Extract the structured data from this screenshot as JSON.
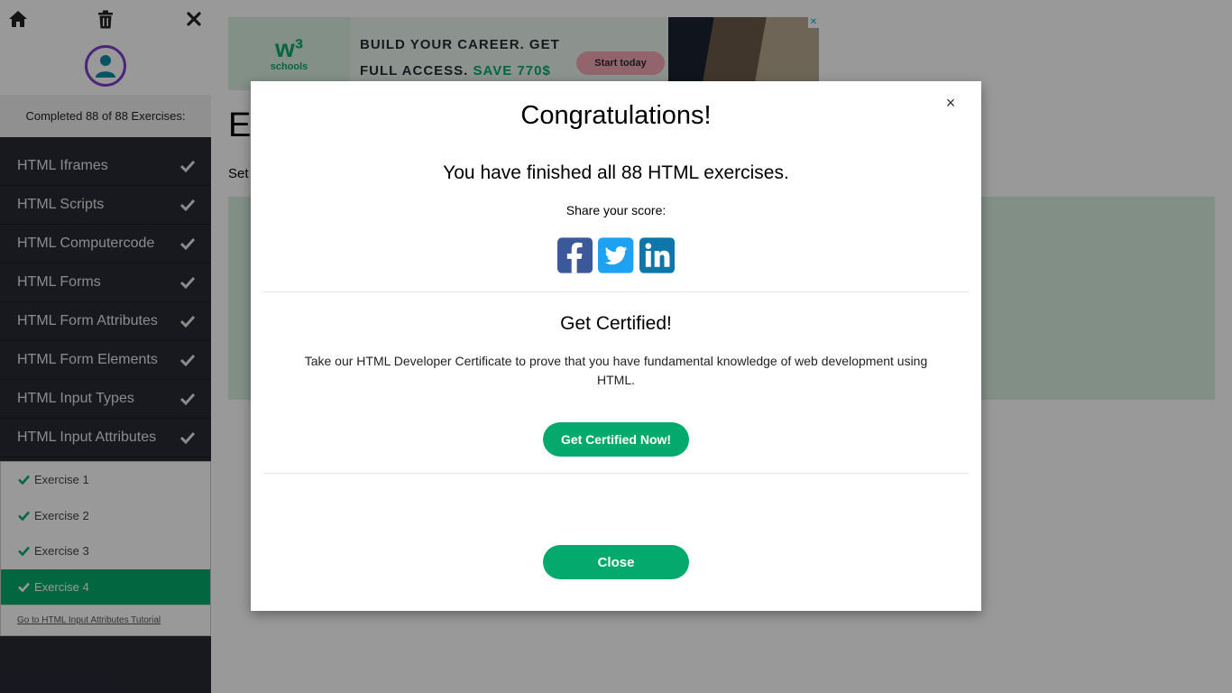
{
  "sidebar": {
    "progress_text": "Completed 88 of 88 Exercises:",
    "topics": [
      {
        "label": "HTML Iframes"
      },
      {
        "label": "HTML Scripts"
      },
      {
        "label": "HTML Computercode"
      },
      {
        "label": "HTML Forms"
      },
      {
        "label": "HTML Form Attributes"
      },
      {
        "label": "HTML Form Elements"
      },
      {
        "label": "HTML Input Types"
      },
      {
        "label": "HTML Input Attributes"
      }
    ],
    "exercises": [
      {
        "label": "Exercise 1"
      },
      {
        "label": "Exercise 2"
      },
      {
        "label": "Exercise 3"
      },
      {
        "label": "Exercise 4"
      }
    ],
    "tutorial_link": "Go to HTML Input Attributes Tutorial"
  },
  "ad": {
    "logo_mark": "w³",
    "logo_sub": "schools",
    "line1": "BUILD YOUR CAREER. GET",
    "line2_a": "FULL ACCESS.",
    "line2_b": "SAVE 770$",
    "button": "Start today"
  },
  "page": {
    "heading": "Ex",
    "instruction": "Set"
  },
  "modal": {
    "title": "Congratulations!",
    "finished": "You have finished all 88 HTML exercises.",
    "share_label": "Share your score:",
    "cert_title": "Get Certified!",
    "cert_text": "Take our HTML Developer Certificate to prove that you have fundamental knowledge of web development using HTML.",
    "cert_button": "Get Certified Now!",
    "close_button": "Close",
    "close_x": "×"
  },
  "colors": {
    "accent": "#04AA6D",
    "sidebar_bg": "#282A35",
    "avatar_ring": "#7d3fc7",
    "facebook": "#3b5998",
    "twitter": "#1da1f2",
    "linkedin": "#0e76a8"
  }
}
